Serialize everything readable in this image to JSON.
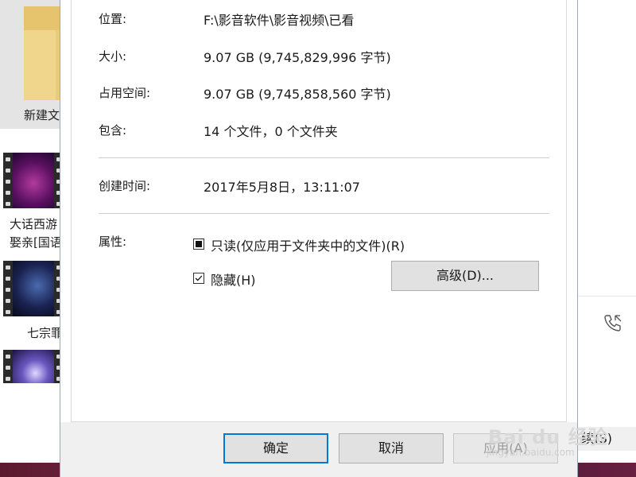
{
  "background": {
    "folder_label": "新建文",
    "videos": [
      {
        "label_line1": "大话西游",
        "label_line2": "娶亲[国语"
      },
      {
        "label_line1": "七宗罪",
        "label_line2": ""
      },
      {
        "label_line1": "",
        "label_line2": ""
      }
    ],
    "right_button_label": "续(S)",
    "phone_icon": "phone-call-icon"
  },
  "properties": {
    "location_label": "位置:",
    "location_value": "F:\\影音软件\\影音视频\\已看",
    "size_label": "大小:",
    "size_value": "9.07 GB (9,745,829,996 字节)",
    "disk_size_label": "占用空间:",
    "disk_size_value": "9.07 GB (9,745,858,560 字节)",
    "contains_label": "包含:",
    "contains_value": "14 个文件，0 个文件夹",
    "created_label": "创建时间:",
    "created_value": "2017年5月8日，13:11:07",
    "attributes_label": "属性:",
    "readonly_label": "只读(仅应用于文件夹中的文件)(R)",
    "readonly_state": "indeterminate",
    "hidden_label": "隐藏(H)",
    "hidden_state": "checked",
    "advanced_button": "高级(D)..."
  },
  "footer": {
    "ok_label": "确定",
    "cancel_label": "取消",
    "apply_label": "应用(A)"
  },
  "watermark": {
    "text": "Bai du 经验",
    "sub": "jingyan.baidu.com"
  },
  "colors": {
    "accent": "#0078d7",
    "dialog_bg": "#ffffff",
    "footer_bg": "#f0f0f0"
  }
}
